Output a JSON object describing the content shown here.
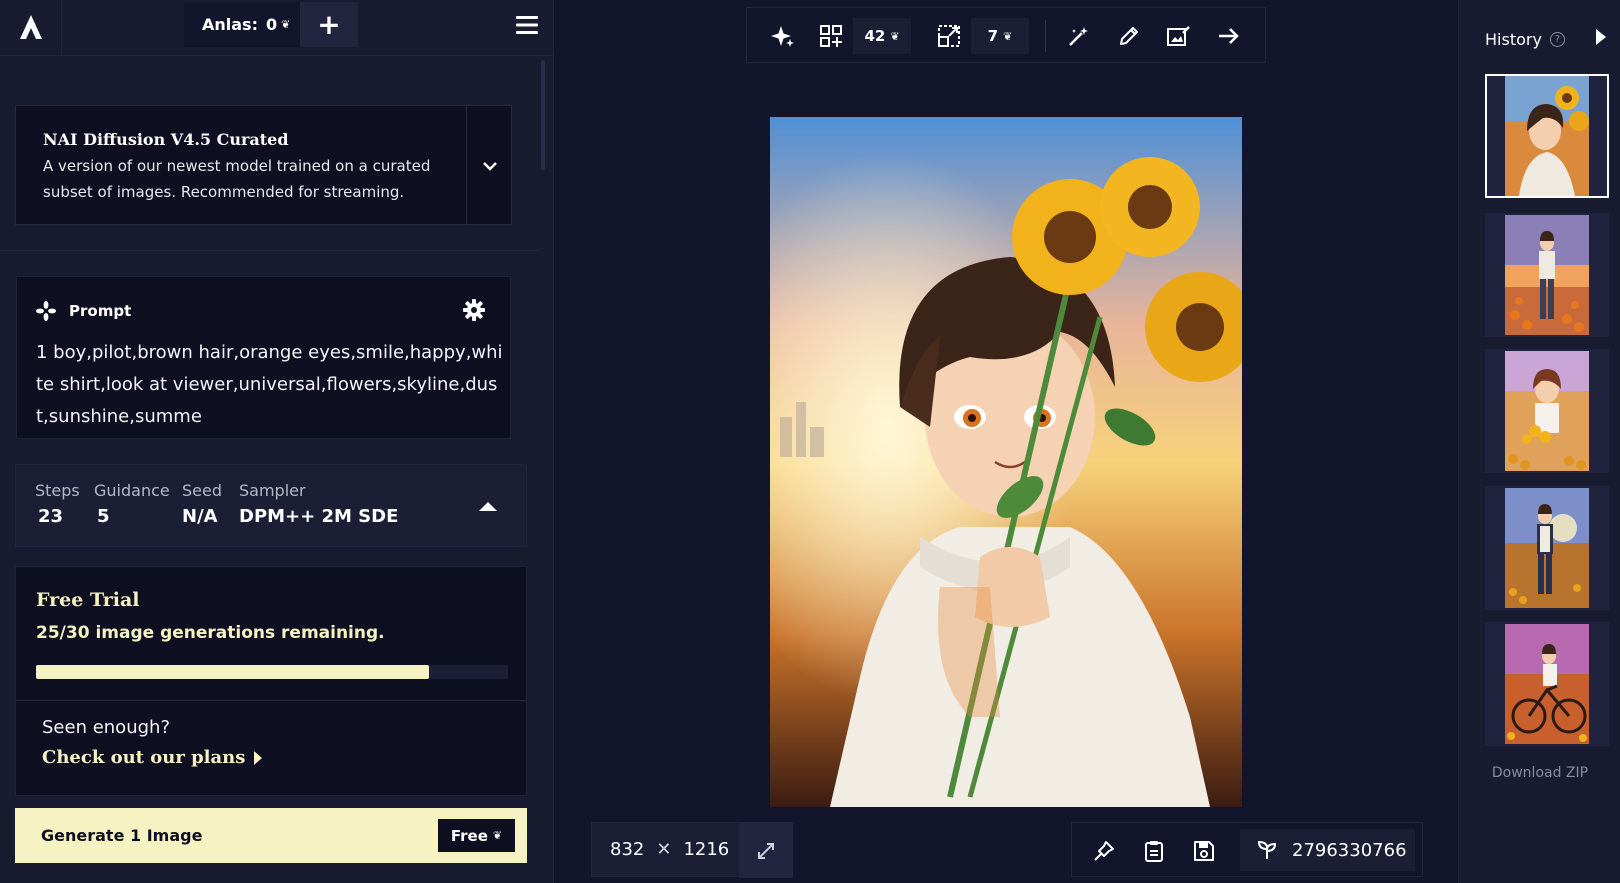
{
  "topbar": {
    "anlas_label": "Anlas:",
    "anlas_value": "0",
    "add_label": "+"
  },
  "model": {
    "name": "NAI Diffusion V4.5 Curated",
    "description": "A version of our newest model trained on a curated subset of images. Recommended for streaming."
  },
  "prompt": {
    "label": "Prompt",
    "text": "1 boy,pilot,brown hair,orange eyes,smile,happy,white shirt,look at viewer,universal,flowers,skyline,dust,sunshine,summe"
  },
  "params": {
    "steps_label": "Steps",
    "steps_value": "23",
    "guidance_label": "Guidance",
    "guidance_value": "5",
    "seed_label": "Seed",
    "seed_value": "N/A",
    "sampler_label": "Sampler",
    "sampler_value": "DPM++ 2M SDE"
  },
  "trial": {
    "title": "Free Trial",
    "subtitle": "25/30 image generations remaining.",
    "remaining_fraction": 0.833,
    "seen_enough": "Seen enough?",
    "plans_link": "Check out our plans"
  },
  "generate": {
    "label": "Generate 1 Image",
    "cost_label": "Free"
  },
  "toolbar": {
    "variations_cost": "42",
    "upscale_cost": "7",
    "icons": [
      "sparkle-icon",
      "grid-plus-icon",
      "upscale-icon",
      "magic-wand-icon",
      "pencil-icon",
      "image-edit-icon",
      "arrow-right-icon"
    ]
  },
  "canvas": {
    "width": "832",
    "times": "✕",
    "height": "1216"
  },
  "seed_display": "2796330766",
  "history": {
    "title": "History",
    "help": "?",
    "download": "Download ZIP",
    "thumb_count": 5
  },
  "colors": {
    "background": "#13152c",
    "panel": "#191b31",
    "card": "#0e0f21",
    "accent": "#f5f3c1"
  }
}
